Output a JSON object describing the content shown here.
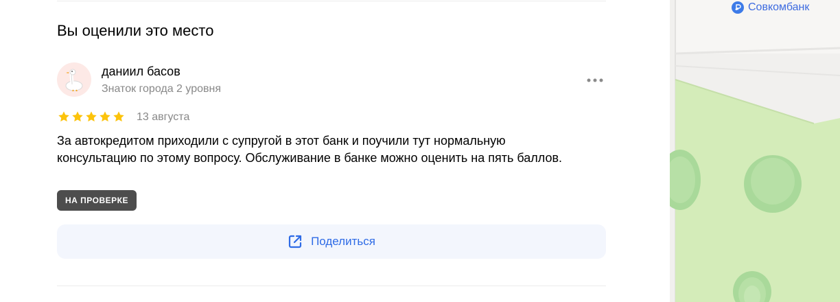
{
  "section": {
    "title": "Вы оценили это место"
  },
  "review": {
    "author": {
      "name": "даниил басов",
      "level": "Знаток города 2 уровня",
      "avatar_icon": "goose-icon"
    },
    "rating": 5,
    "rating_max": 5,
    "date": "13 августа",
    "text": "За автокредитом приходили с супругой в этот банк и поучили тут нормальную консультацию по этому вопросу. Обслуживание в банке можно оценить на пять баллов.",
    "status_badge": "НА ПРОВЕРКЕ",
    "more_icon": "more-dots-icon"
  },
  "share": {
    "label": "Поделиться",
    "icon": "share-icon"
  },
  "map": {
    "poi_label": "Совкомбанк",
    "poi_icon": "bank-icon",
    "colors": {
      "park": "#d4ecb9",
      "tree": "#a9d99a",
      "road": "#f1f0ee"
    }
  },
  "colors": {
    "accent": "#2e6be6",
    "star": "#fcc30b",
    "badge_bg": "#4d4d4d",
    "share_bg": "#f3f6fd"
  }
}
